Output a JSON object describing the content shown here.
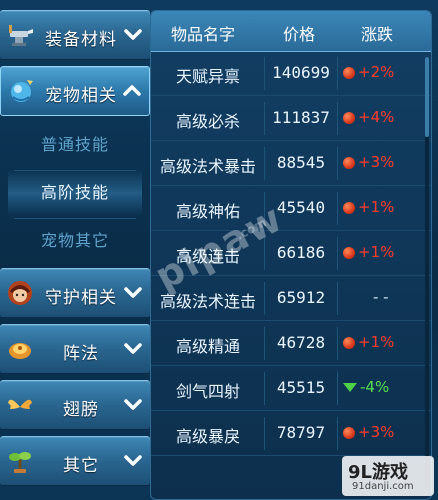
{
  "sidebar": {
    "categories": [
      {
        "label": "装备材料",
        "icon": "anvil-icon",
        "expanded": false
      },
      {
        "label": "宠物相关",
        "icon": "pet-globe-icon",
        "expanded": true,
        "subitems": [
          {
            "label": "普通技能",
            "selected": false
          },
          {
            "label": "高阶技能",
            "selected": true
          },
          {
            "label": "宠物其它",
            "selected": false
          }
        ]
      },
      {
        "label": "守护相关",
        "icon": "guardian-avatar-icon",
        "expanded": false
      },
      {
        "label": "阵法",
        "icon": "formation-icon",
        "expanded": false
      },
      {
        "label": "翅膀",
        "icon": "wings-icon",
        "expanded": false
      },
      {
        "label": "其它",
        "icon": "misc-plant-icon",
        "expanded": false
      }
    ]
  },
  "table": {
    "headers": {
      "name": "物品名字",
      "price": "价格",
      "change": "涨跌"
    },
    "rows": [
      {
        "name": "天赋异禀",
        "price": "140699",
        "change": "+2%",
        "trend": "up"
      },
      {
        "name": "高级必杀",
        "price": "111837",
        "change": "+4%",
        "trend": "up"
      },
      {
        "name": "高级法术暴击",
        "price": "88545",
        "change": "+3%",
        "trend": "up"
      },
      {
        "name": "高级神佑",
        "price": "45540",
        "change": "+1%",
        "trend": "up"
      },
      {
        "name": "高级连击",
        "price": "66186",
        "change": "+1%",
        "trend": "up"
      },
      {
        "name": "高级法术连击",
        "price": "65912",
        "change": "- -",
        "trend": "flat"
      },
      {
        "name": "高级精通",
        "price": "46728",
        "change": "+1%",
        "trend": "up"
      },
      {
        "name": "剑气四射",
        "price": "45515",
        "change": "-4%",
        "trend": "down"
      },
      {
        "name": "高级暴戾",
        "price": "78797",
        "change": "+3%",
        "trend": "up"
      }
    ]
  },
  "watermark": {
    "text": "pipaw",
    "sub": ".com"
  },
  "corner_logo": {
    "title": "9L游戏",
    "url": "91danji.com"
  },
  "colors": {
    "up": "#ff3b2a",
    "down": "#55e04c",
    "accent": "#3b87b8"
  }
}
